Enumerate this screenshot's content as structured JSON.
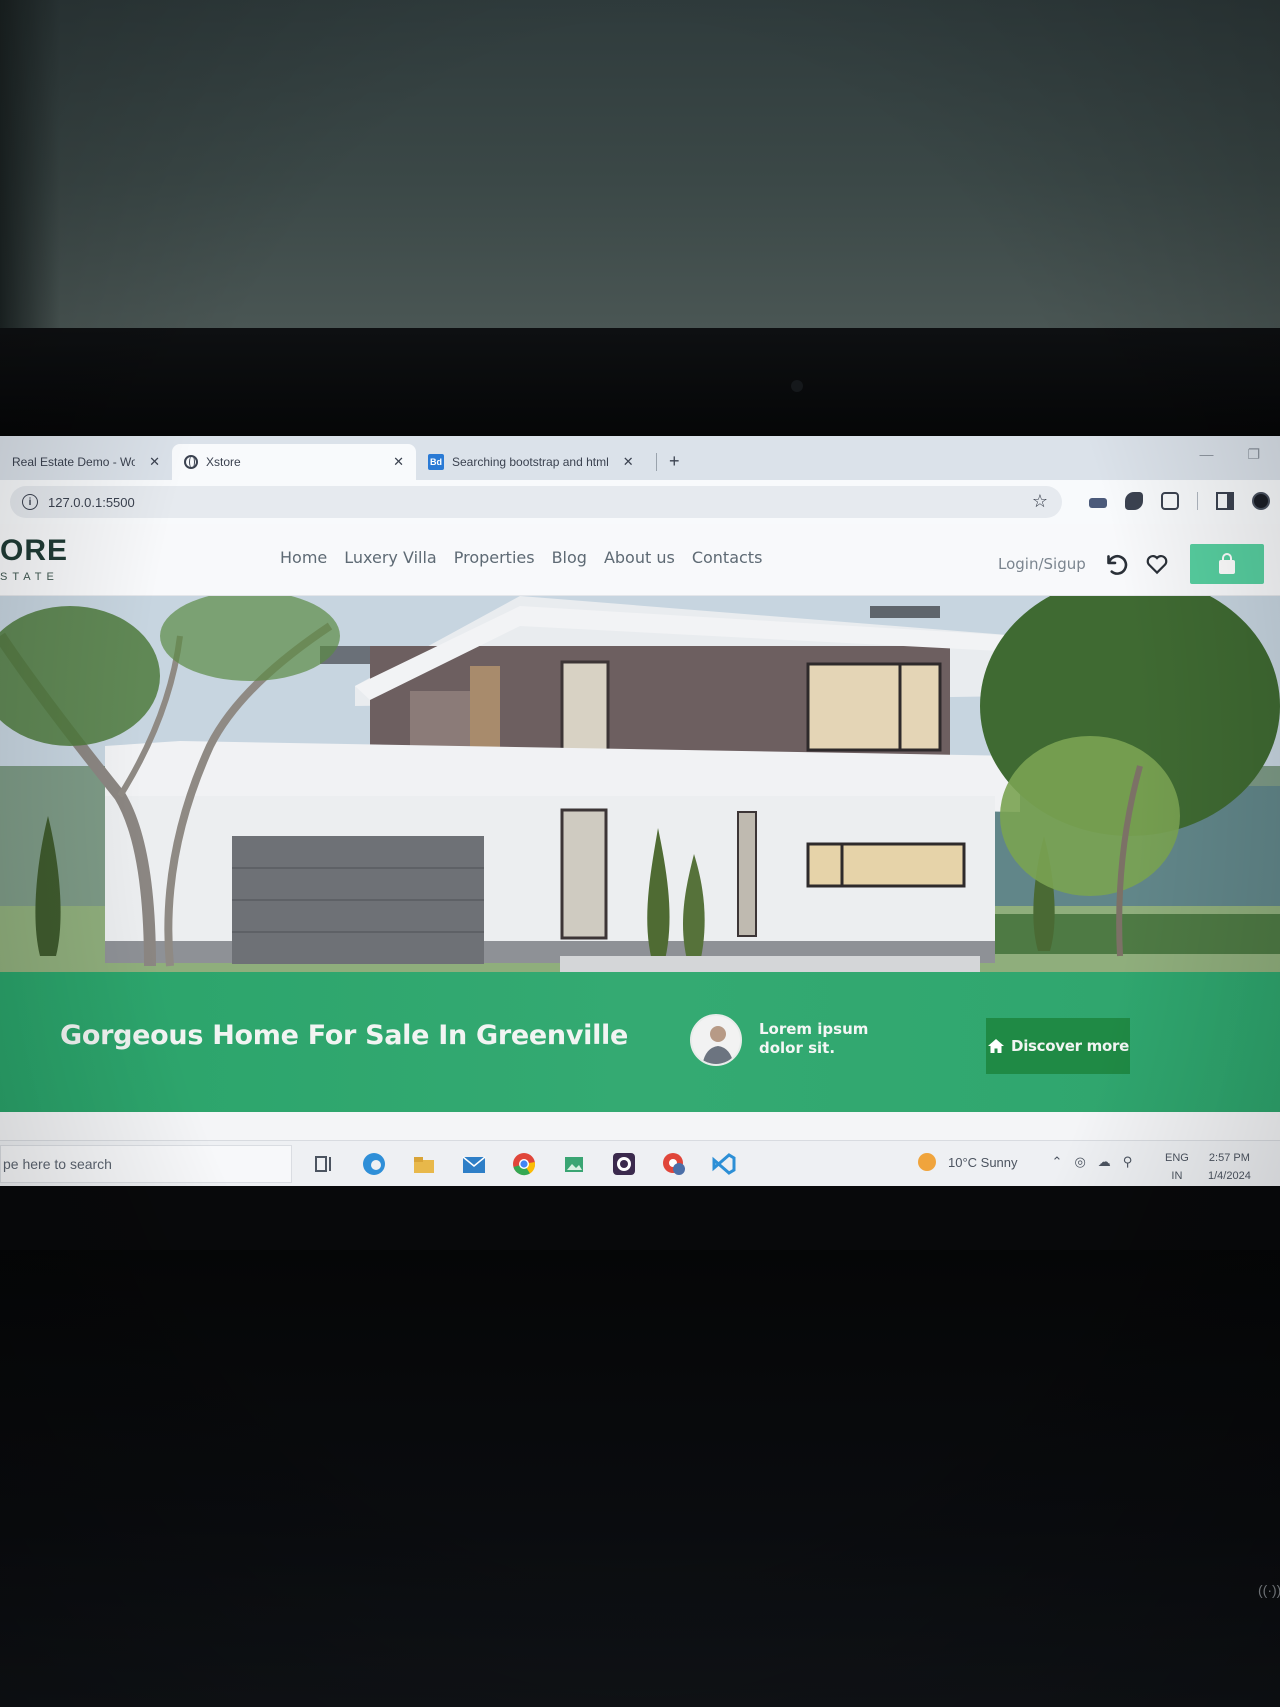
{
  "browser": {
    "tabs": [
      {
        "title": "Real Estate Demo - Woo",
        "icon": "web-page-icon",
        "active": false
      },
      {
        "title": "Xstore",
        "icon": "globe-icon",
        "active": true
      },
      {
        "title": "Searching bootstrap and html",
        "icon": "bootstrap-icon",
        "active": false
      }
    ],
    "close_glyph": "✕",
    "new_tab_glyph": "+",
    "url": "127.0.0.1:5500"
  },
  "site": {
    "logo_main": "ORE",
    "logo_sub": "STATE",
    "nav": [
      "Home",
      "Luxery Villa",
      "Properties",
      "Blog",
      "About us",
      "Contacts"
    ],
    "login_label": "Login/Sigup",
    "accent_color": "#57cfa0"
  },
  "banner": {
    "title": "Gorgeous Home For Sale In Greenville",
    "agent_text": "Lorem ipsum dolor sit.",
    "button_label": "Discover more",
    "background_color": "#2ea56d",
    "button_color": "#1f8a45"
  },
  "taskbar": {
    "search_placeholder": "pe here to search",
    "weather": "10°C  Sunny",
    "lang_line1": "ENG",
    "lang_line2": "IN",
    "time": "2:57 PM",
    "date": "1/4/2024"
  }
}
